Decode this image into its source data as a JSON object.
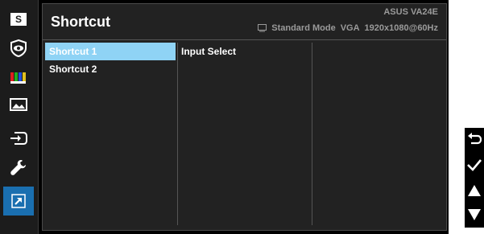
{
  "header": {
    "title": "Shortcut",
    "model": "ASUS  VA24E",
    "mode": "Standard Mode",
    "input": "VGA",
    "resolution": "1920x1080@60Hz"
  },
  "sidebar": {
    "items": [
      {
        "icon": "splendid-s-icon"
      },
      {
        "icon": "eye-care-icon"
      },
      {
        "icon": "color-icon"
      },
      {
        "icon": "image-icon"
      },
      {
        "icon": "input-select-icon"
      },
      {
        "icon": "system-setup-wrench-icon"
      },
      {
        "icon": "shortcut-arrow-icon",
        "active": true
      }
    ]
  },
  "menu": {
    "items": [
      {
        "label": "Shortcut 1",
        "selected": true
      },
      {
        "label": "Shortcut 2",
        "selected": false
      }
    ]
  },
  "submenu": {
    "value": "Input Select"
  },
  "hints": [
    {
      "icon": "back-icon"
    },
    {
      "icon": "confirm-check-icon"
    },
    {
      "icon": "up-arrow-icon"
    },
    {
      "icon": "down-arrow-icon"
    }
  ],
  "colors": {
    "background": "#000000",
    "panel": "#222222",
    "active_icon": "#1a6fb0",
    "selected_item": "#8fd3f5",
    "text": "#ffffff",
    "muted_text": "#9a9a9a"
  }
}
